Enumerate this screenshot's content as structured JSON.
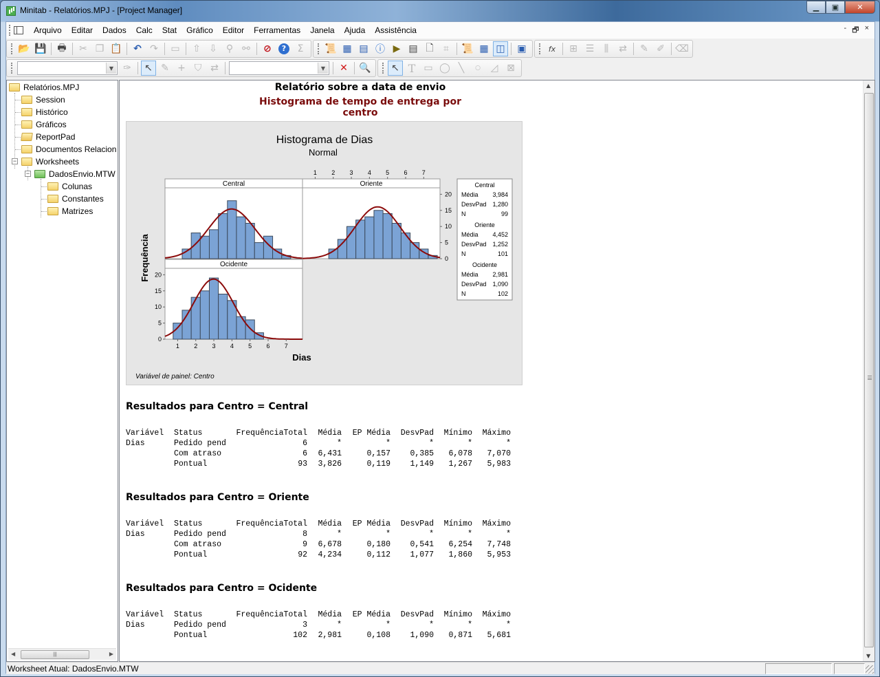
{
  "window": {
    "title": "Minitab - Relatórios.MPJ - [Project Manager]",
    "controls": [
      "minimize",
      "maximize",
      "close"
    ]
  },
  "menubar": {
    "items": [
      "Arquivo",
      "Editar",
      "Dados",
      "Calc",
      "Stat",
      "Gráfico",
      "Editor",
      "Ferramentas",
      "Janela",
      "Ajuda",
      "Assistência"
    ],
    "mdi_controls": [
      "-",
      "🗗",
      "×"
    ]
  },
  "toolbars": {
    "standard": [
      "open-icon",
      "save-icon",
      "print-icon",
      "cut-icon",
      "copy-icon",
      "paste-icon",
      "undo-icon",
      "redo-icon",
      "edit-last-dialog-icon",
      "previous-command-icon",
      "next-command-icon",
      "find-icon",
      "replace-icon",
      "cancel-icon",
      "help-icon",
      "stat-guide-icon"
    ],
    "project_manager": [
      "session-folder-icon",
      "show-worksheets-icon",
      "show-graphs-icon",
      "info-icon",
      "history-icon",
      "reportpad-icon",
      "related-documents-icon",
      "design-icon",
      "session-window-icon",
      "data-window-icon",
      "project-manager-icon",
      "close-all-graphs-icon"
    ],
    "worksheet": [
      "formula-icon",
      "insert-cells-icon",
      "insert-rows-icon",
      "insert-columns-icon",
      "move-columns-icon",
      "brush-icon",
      "brush-down-icon",
      "clear-cells-icon"
    ],
    "brush": {
      "combo1_value": "",
      "combo2_value": ""
    },
    "graph_editing": [
      "select-icon",
      "text-icon",
      "rectangle-icon",
      "ellipse-icon",
      "line-icon",
      "marker-icon",
      "polyline-icon",
      "polygon-icon"
    ]
  },
  "project_tree": {
    "root": "Relatórios.MPJ",
    "items": [
      {
        "label": "Session",
        "level": 1
      },
      {
        "label": "Histórico",
        "level": 1
      },
      {
        "label": "Gráficos",
        "level": 1
      },
      {
        "label": "ReportPad",
        "level": 1
      },
      {
        "label": "Documentos Relacion",
        "level": 1
      },
      {
        "label": "Worksheets",
        "level": 1
      },
      {
        "label": "DadosEnvio.MTW",
        "level": 2
      },
      {
        "label": "Colunas",
        "level": 3
      },
      {
        "label": "Constantes",
        "level": 3
      },
      {
        "label": "Matrizes",
        "level": 3
      }
    ]
  },
  "report": {
    "title": "Relatório sobre a data de envio",
    "subtitle": "Histograma de tempo de entrega por centro",
    "colors": {
      "title": "#000000",
      "subtitle": "#7a0c0c"
    },
    "results": [
      {
        "heading": "Resultados para Centro = Central",
        "columns": [
          "Variável",
          "Status",
          "FrequênciaTotal",
          "Média",
          "EP Média",
          "DesvPad",
          "Mínimo",
          "Máximo"
        ],
        "rows": [
          [
            "Dias",
            "Pedido pend",
            "6",
            "*",
            "*",
            "*",
            "*",
            "*"
          ],
          [
            "",
            "Com atraso",
            "6",
            "6,431",
            "0,157",
            "0,385",
            "6,078",
            "7,070"
          ],
          [
            "",
            "Pontual",
            "93",
            "3,826",
            "0,119",
            "1,149",
            "1,267",
            "5,983"
          ]
        ]
      },
      {
        "heading": "Resultados para Centro = Oriente",
        "columns": [
          "Variável",
          "Status",
          "FrequênciaTotal",
          "Média",
          "EP Média",
          "DesvPad",
          "Mínimo",
          "Máximo"
        ],
        "rows": [
          [
            "Dias",
            "Pedido pend",
            "8",
            "*",
            "*",
            "*",
            "*",
            "*"
          ],
          [
            "",
            "Com atraso",
            "9",
            "6,678",
            "0,180",
            "0,541",
            "6,254",
            "7,748"
          ],
          [
            "",
            "Pontual",
            "92",
            "4,234",
            "0,112",
            "1,077",
            "1,860",
            "5,953"
          ]
        ]
      },
      {
        "heading": "Resultados para Centro = Ocidente",
        "columns": [
          "Variável",
          "Status",
          "FrequênciaTotal",
          "Média",
          "EP Média",
          "DesvPad",
          "Mínimo",
          "Máximo"
        ],
        "rows": [
          [
            "Dias",
            "Pedido pend",
            "3",
            "*",
            "*",
            "*",
            "*",
            "*"
          ],
          [
            "",
            "Pontual",
            "102",
            "2,981",
            "0,108",
            "1,090",
            "0,871",
            "5,681"
          ]
        ]
      }
    ]
  },
  "chart_data": {
    "type": "bar",
    "subtype": "paneled histogram with normal fit",
    "title": "Histograma de Dias",
    "subtitle": "Normal",
    "xlabel": "Dias",
    "ylabel": "Frequência",
    "footnote": "Variável de painel: Centro",
    "xlim": [
      0.3,
      7.9
    ],
    "ylim": [
      0,
      22
    ],
    "xticks": [
      1,
      2,
      3,
      4,
      5,
      6,
      7
    ],
    "yticks": [
      0,
      5,
      10,
      15,
      20
    ],
    "bin_width": 0.5,
    "colors": {
      "bar": "#7ba3d5",
      "bar_edge": "#3c4a5c",
      "fit": "#8b0a0a",
      "panel_bg": "#ffffff",
      "figure_bg": "#e6e6e6"
    },
    "panels": [
      {
        "name": "Central",
        "bin_start": 1.25,
        "counts": [
          3,
          8,
          7,
          9,
          14,
          18,
          13,
          11,
          5,
          7,
          3,
          1
        ],
        "mean": 3.984,
        "stdev": 1.28,
        "n": 99
      },
      {
        "name": "Oriente",
        "bin_start": 1.75,
        "counts": [
          3,
          6,
          10,
          12,
          13,
          15,
          14,
          11,
          8,
          5,
          3,
          1
        ],
        "mean": 4.452,
        "stdev": 1.252,
        "n": 101
      },
      {
        "name": "Ocidente",
        "bin_start": 0.75,
        "counts": [
          5,
          9,
          13,
          15,
          19,
          14,
          12,
          7,
          6,
          2
        ],
        "mean": 2.981,
        "stdev": 1.09,
        "n": 102
      }
    ],
    "legend": {
      "placement": "right",
      "entries": [
        {
          "group": "Central",
          "rows": [
            [
              "Média",
              "3,984"
            ],
            [
              "DesvPad",
              "1,280"
            ],
            [
              "N",
              "99"
            ]
          ]
        },
        {
          "group": "Oriente",
          "rows": [
            [
              "Média",
              "4,452"
            ],
            [
              "DesvPad",
              "1,252"
            ],
            [
              "N",
              "101"
            ]
          ]
        },
        {
          "group": "Ocidente",
          "rows": [
            [
              "Média",
              "2,981"
            ],
            [
              "DesvPad",
              "1,090"
            ],
            [
              "N",
              "102"
            ]
          ]
        }
      ]
    }
  },
  "statusbar": {
    "text": "Worksheet Atual: DadosEnvio.MTW"
  }
}
